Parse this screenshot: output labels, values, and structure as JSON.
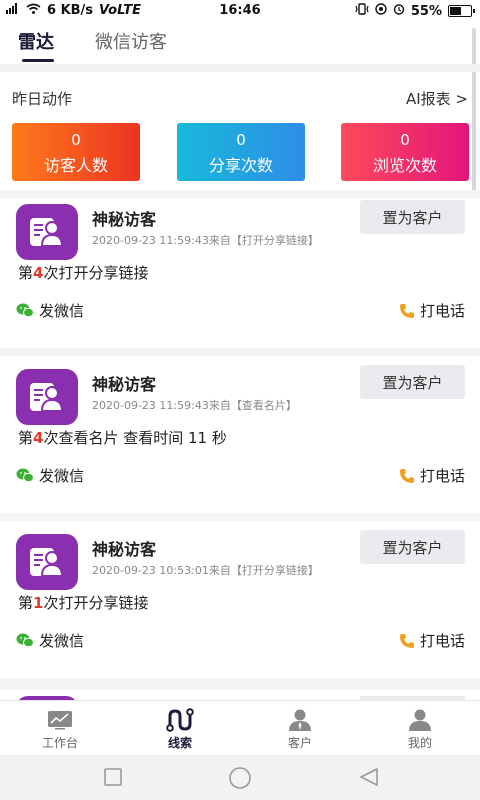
{
  "status_bar": {
    "network": "6 KB/s",
    "volte": "VoLTE",
    "time": "16:46",
    "battery": "55%",
    "battery_level": 0.55
  },
  "tabs": [
    {
      "label": "雷达",
      "active": true
    },
    {
      "label": "微信访客",
      "active": false
    }
  ],
  "summary": {
    "title": "昨日动作",
    "report_link": "AI报表 >",
    "stats": [
      {
        "value": "0",
        "label": "访客人数"
      },
      {
        "value": "0",
        "label": "分享次数"
      },
      {
        "value": "0",
        "label": "浏览次数"
      }
    ]
  },
  "cards": [
    {
      "name": "神秘访客",
      "meta": "2020-09-23 11:59:43来自【打开分享链接】",
      "action_prefix": "第",
      "action_count": "4",
      "action_suffix": "次打开分享链接",
      "button": "置为客户",
      "wechat": "发微信",
      "call": "打电话"
    },
    {
      "name": "神秘访客",
      "meta": "2020-09-23 11:59:43来自【查看名片】",
      "action_prefix": "第",
      "action_count": "4",
      "action_suffix": "次查看名片 查看时间 11 秒",
      "button": "置为客户",
      "wechat": "发微信",
      "call": "打电话"
    },
    {
      "name": "神秘访客",
      "meta": "2020-09-23 10:53:01来自【打开分享链接】",
      "action_prefix": "第",
      "action_count": "1",
      "action_suffix": "次打开分享链接",
      "button": "置为客户",
      "wechat": "发微信",
      "call": "打电话"
    }
  ],
  "bottom_nav": [
    {
      "label": "工作台",
      "icon": "dashboard-icon",
      "active": false
    },
    {
      "label": "线索",
      "icon": "route-icon",
      "active": true
    },
    {
      "label": "客户",
      "icon": "customer-icon",
      "active": false
    },
    {
      "label": "我的",
      "icon": "profile-icon",
      "active": false
    }
  ],
  "colors": {
    "accent": "#1b1b3a",
    "highlight": "#e23a2a",
    "avatar": "#8a2fb0",
    "wechat": "#3cb034",
    "phone": "#f0a020"
  }
}
